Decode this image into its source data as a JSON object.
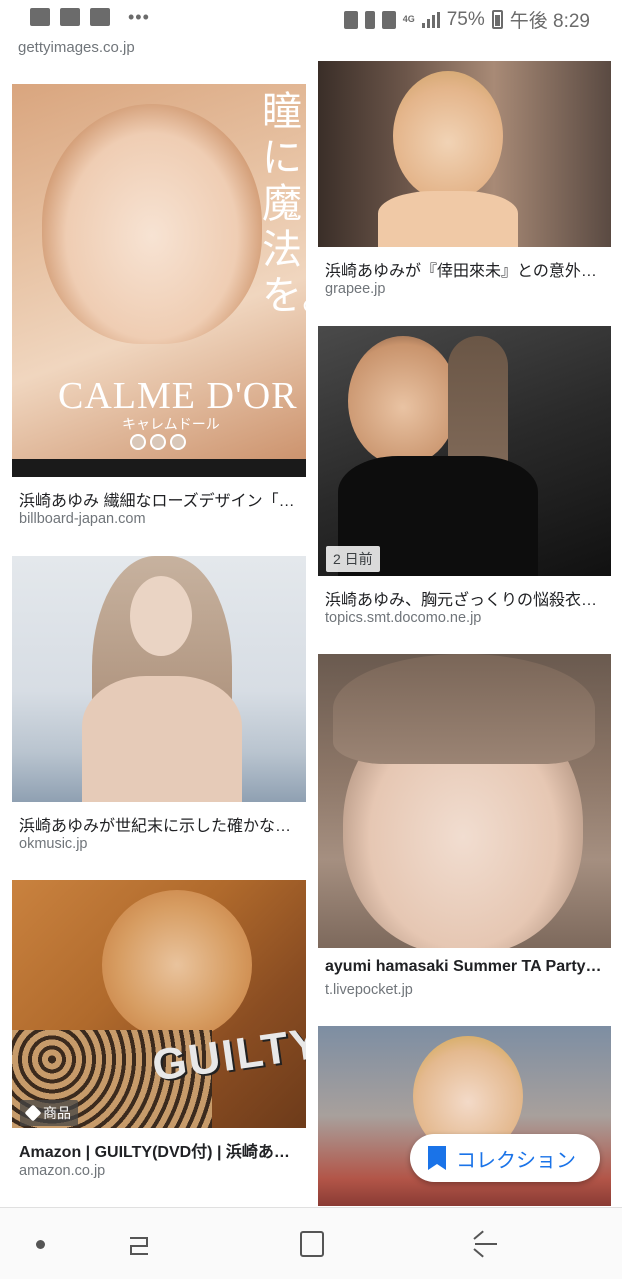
{
  "status_bar": {
    "left_icons": [
      "mail-icon",
      "email-icon",
      "photo-icon"
    ],
    "overflow": "•••",
    "network": "4G",
    "battery_percent": "75%",
    "time": "午後 8:29"
  },
  "top_source": "gettyimages.co.jp",
  "results": [
    {
      "title": "浜崎あゆみ 繊細なローズデザイン「…",
      "source": "billboard-japan.com",
      "ad_title": "瞳に魔法を。",
      "ad_brand": "CALME D'OR",
      "ad_sub": "キャレムドール"
    },
    {
      "title": "浜崎あゆみが世紀末に示した確かな…",
      "source": "okmusic.jp"
    },
    {
      "title": "Amazon | GUILTY(DVD付) | 浜崎あ…",
      "source": "amazon.co.jp",
      "badge": "商品",
      "cover_text": "GUILTY"
    },
    {
      "title": "浜崎あゆみが『倖田來未』との意外…",
      "source": "grapee.jp"
    },
    {
      "title": "浜崎あゆみ、胸元ざっくりの悩殺衣…",
      "source": "topics.smt.docomo.ne.jp",
      "badge": "2 日前"
    },
    {
      "title": "ayumi hamasaki Summer TA Party…",
      "source": "t.livepocket.jp"
    }
  ],
  "collection_button": {
    "label": "コレクション"
  },
  "colors": {
    "accent": "#1a73e8",
    "secondary_text": "#70757a"
  }
}
